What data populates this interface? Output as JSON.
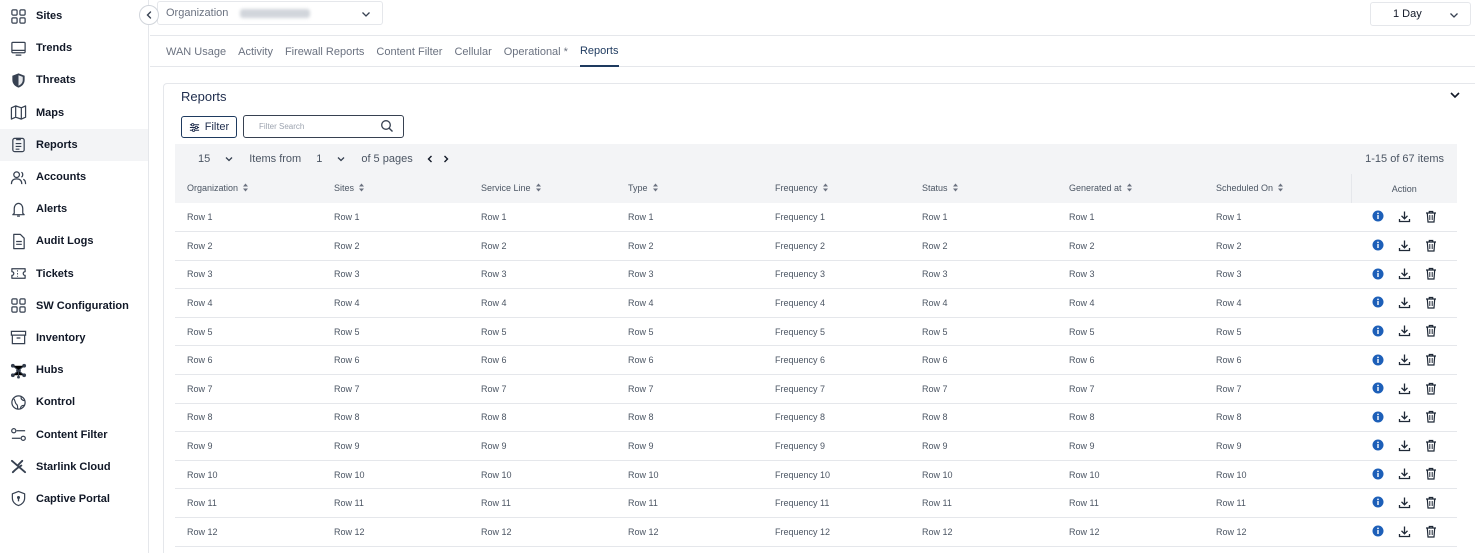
{
  "sidebar": {
    "items": [
      {
        "label": "Sites",
        "icon": "grid-icon"
      },
      {
        "label": "Trends",
        "icon": "monitor-icon"
      },
      {
        "label": "Threats",
        "icon": "shield-icon"
      },
      {
        "label": "Maps",
        "icon": "map-icon"
      },
      {
        "label": "Reports",
        "icon": "clipboard-icon",
        "active": true
      },
      {
        "label": "Accounts",
        "icon": "users-icon"
      },
      {
        "label": "Alerts",
        "icon": "bell-icon"
      },
      {
        "label": "Audit Logs",
        "icon": "document-icon"
      },
      {
        "label": "Tickets",
        "icon": "ticket-icon"
      },
      {
        "label": "SW Configuration",
        "icon": "grid-icon"
      },
      {
        "label": "Inventory",
        "icon": "archive-icon"
      },
      {
        "label": "Hubs",
        "icon": "hub-icon"
      },
      {
        "label": "Kontrol",
        "icon": "globe-icon"
      },
      {
        "label": "Content Filter",
        "icon": "sliders-icon"
      },
      {
        "label": "Starlink Cloud",
        "icon": "starlink-icon"
      },
      {
        "label": "Captive Portal",
        "icon": "shield-lock-icon"
      }
    ]
  },
  "topbar": {
    "org_label": "Organization",
    "range_value": "1 Day"
  },
  "tabs": [
    "WAN Usage",
    "Activity",
    "Firewall Reports",
    "Content Filter",
    "Cellular",
    "Operational *",
    "Reports"
  ],
  "card": {
    "title": "Reports",
    "filter_label": "Filter",
    "search_placeholder": "Filter Search"
  },
  "pager": {
    "per_page": "15",
    "items_from_label": "Items from",
    "page": "1",
    "of_pages": "of 5 pages",
    "total": "1-15 of 67 items"
  },
  "table": {
    "columns": [
      "Organization",
      "Sites",
      "Service Line",
      "Type",
      "Frequency",
      "Status",
      "Generated at",
      "Scheduled On"
    ],
    "action_header": "Action",
    "rows": [
      [
        "Row 1",
        "Row 1",
        "Row 1",
        "Row 1",
        "Frequency 1",
        "Row 1",
        "Row 1",
        "Row 1"
      ],
      [
        "Row 2",
        "Row 2",
        "Row 2",
        "Row 2",
        "Frequency 2",
        "Row 2",
        "Row 2",
        "Row 2"
      ],
      [
        "Row 3",
        "Row 3",
        "Row 3",
        "Row 3",
        "Frequency 3",
        "Row 3",
        "Row 3",
        "Row 3"
      ],
      [
        "Row 4",
        "Row 4",
        "Row 4",
        "Row 4",
        "Frequency 4",
        "Row 4",
        "Row 4",
        "Row 4"
      ],
      [
        "Row 5",
        "Row 5",
        "Row 5",
        "Row 5",
        "Frequency 5",
        "Row 5",
        "Row 5",
        "Row 5"
      ],
      [
        "Row 6",
        "Row 6",
        "Row 6",
        "Row 6",
        "Frequency 6",
        "Row 6",
        "Row 6",
        "Row 6"
      ],
      [
        "Row 7",
        "Row 7",
        "Row 7",
        "Row 7",
        "Frequency 7",
        "Row 7",
        "Row 7",
        "Row 7"
      ],
      [
        "Row 8",
        "Row 8",
        "Row 8",
        "Row 8",
        "Frequency 8",
        "Row 8",
        "Row 8",
        "Row 8"
      ],
      [
        "Row 9",
        "Row 9",
        "Row 9",
        "Row 9",
        "Frequency 9",
        "Row 9",
        "Row 9",
        "Row 9"
      ],
      [
        "Row 10",
        "Row 10",
        "Row 10",
        "Row 10",
        "Frequency 10",
        "Row 10",
        "Row 10",
        "Row 10"
      ],
      [
        "Row 11",
        "Row 11",
        "Row 11",
        "Row 11",
        "Frequency 11",
        "Row 11",
        "Row 11",
        "Row 11"
      ],
      [
        "Row 12",
        "Row 12",
        "Row 12",
        "Row 12",
        "Frequency 12",
        "Row 12",
        "Row 12",
        "Row 12"
      ]
    ]
  },
  "colors": {
    "accent": "#1e3a5f",
    "info_icon": "#1d5fb8",
    "border": "#e5e7eb",
    "header_bg": "#f3f4f6"
  }
}
